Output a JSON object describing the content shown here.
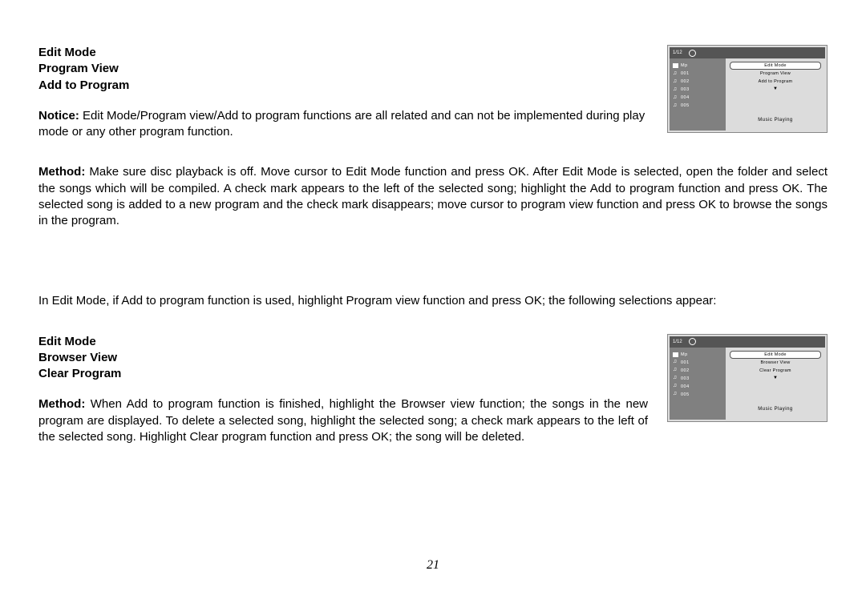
{
  "section1": {
    "headings": [
      "Edit Mode",
      "Program View",
      "Add to Program"
    ],
    "noticeLabel": "Notice:",
    "noticeText": " Edit Mode/Program view/Add to program functions are all related and can not be implemented during play mode or any other program function."
  },
  "methodPara1": {
    "label": "Method:",
    "text": " Make sure disc playback is off. Move cursor to Edit Mode function and press OK. After Edit Mode is selected, open the folder and select the songs which will be compiled. A check mark appears to the left of the selected song; highlight the Add to program function and press OK. The selected song is added to a new program and the check mark disappears; move cursor to program view function and press OK to browse the songs in the program."
  },
  "midPara": "In Edit Mode, if Add to program function is used, highlight Program view function and press OK; the following selections appear:",
  "section2": {
    "headings": [
      "Edit Mode",
      "Browser View",
      "Clear Program"
    ],
    "methodLabel": "Method:",
    "methodText": " When Add to program function is finished, highlight the Browser view function; the songs in the new program are displayed. To delete a selected song, highlight the selected song; a check mark appears to the left of the selected song. Highlight Clear program function and press OK; the song will be deleted."
  },
  "figure1": {
    "counter": "1/12",
    "folderLabel": "Mp",
    "tracks": [
      "001",
      "002",
      "003",
      "004",
      "005"
    ],
    "menu": [
      "Edit Mode",
      "Program View",
      "Add to Program"
    ],
    "status": "Music Playing"
  },
  "figure2": {
    "counter": "1/12",
    "folderLabel": "Mp",
    "tracks": [
      "001",
      "002",
      "003",
      "004",
      "005"
    ],
    "menu": [
      "Edit Mode",
      "Browser View",
      "Clear Program"
    ],
    "status": "Music Playing"
  },
  "pageNumber": "21"
}
